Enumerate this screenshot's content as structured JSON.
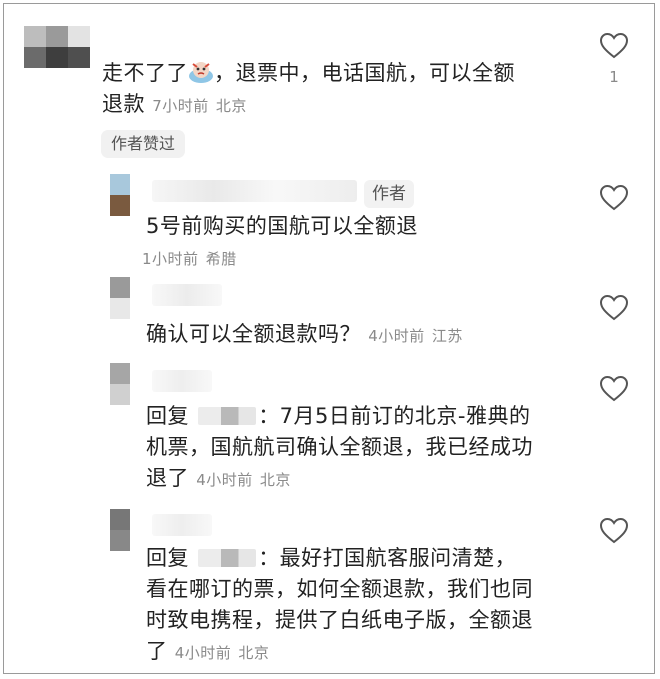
{
  "comments": [
    {
      "segments": [
        "走不了了",
        "，退票中，电话国航，可以全额",
        "退款"
      ],
      "time": "7小时前",
      "location": "北京",
      "likes": "1",
      "liked_badge": "作者赞过"
    },
    {
      "author_badge": "作者",
      "text": "5号前购买的国航可以全额退",
      "time": "1小时前",
      "location": "希腊"
    },
    {
      "text": "确认可以全额退款吗？",
      "time": "4小时前",
      "location": "江苏"
    },
    {
      "reply_prefix": "回复",
      "lines": [
        "：7月5日前订的北京-雅典的",
        "机票，国航航司确认全额退，我已经成功",
        "退了"
      ],
      "time": "4小时前",
      "location": "北京"
    },
    {
      "reply_prefix": "回复",
      "lines": [
        "：最好打国航客服问清楚，",
        "看在哪订的票，如何全额退款，我们也同",
        "时致电携程，提供了白纸电子版，全额退",
        "了"
      ],
      "time": "4小时前",
      "location": "北京"
    }
  ],
  "icons": {
    "like": "heart-outline-icon",
    "emoji": "crying-face-emoji-icon"
  },
  "colors": {
    "text": "#222222",
    "meta": "#8a8a8a",
    "heart_stroke": "#555555"
  }
}
